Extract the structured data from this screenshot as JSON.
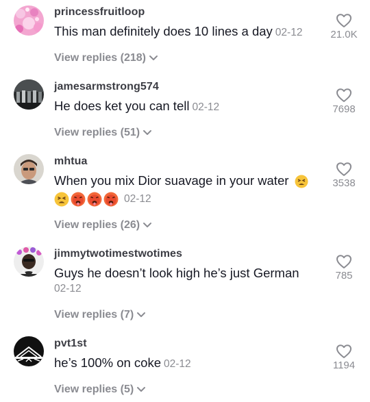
{
  "comments": [
    {
      "username": "princessfruitloop",
      "text": "This man definitely does 10 lines a day",
      "date": "02-12",
      "likes": "21.0K",
      "replies": "View replies (218)",
      "avatar": "pink-floral-avatar"
    },
    {
      "username": "jamesarmstrong574",
      "text": "He does ket you can tell",
      "date": "02-12",
      "likes": "7698",
      "replies": "View replies (51)",
      "avatar": "dark-group-photo-avatar"
    },
    {
      "username": "mhtua",
      "text": "When you mix Dior suavage in your water",
      "date": "02-12",
      "likes": "3538",
      "replies": "View replies (26)",
      "avatar": "man-portrait-avatar",
      "emojis": [
        "tired-face",
        "hot-face",
        "hot-face",
        "hot-face"
      ]
    },
    {
      "username": "jimmytwotimestwotimes",
      "text": "Guys he doesn’t look high he’s just German",
      "date": "02-12",
      "likes": "785",
      "replies": "View replies (7)",
      "avatar": "man-flower-crown-avatar"
    },
    {
      "username": "pvt1st",
      "text": "he’s 100% on coke",
      "date": "02-12",
      "likes": "1194",
      "replies": "View replies (5)",
      "avatar": "black-white-logo-avatar"
    }
  ],
  "colors": {
    "username": "#3b3c43",
    "text": "#161823",
    "muted": "#8a8b91"
  }
}
